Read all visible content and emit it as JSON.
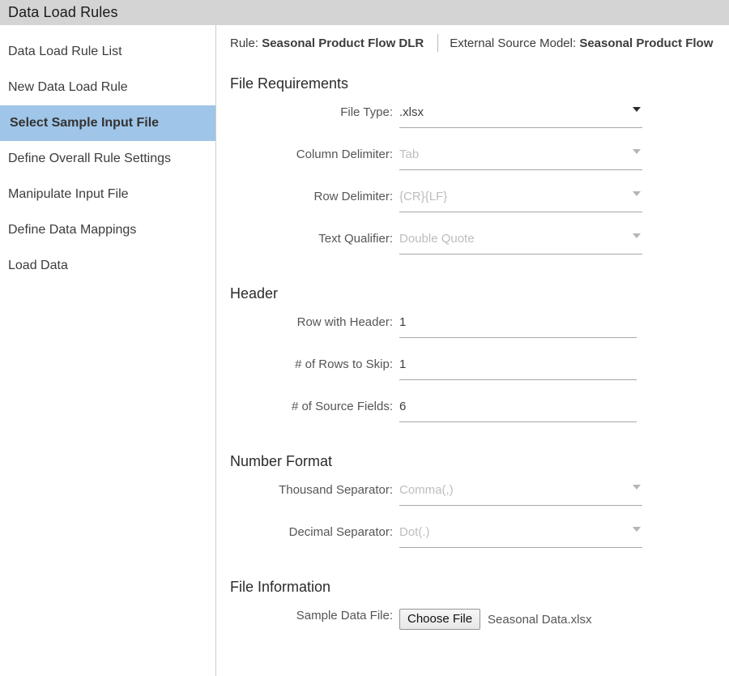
{
  "window": {
    "title": "Data Load Rules"
  },
  "sidebar": {
    "items": [
      {
        "label": "Data Load Rule List",
        "selected": false
      },
      {
        "label": "New Data Load Rule",
        "selected": false
      },
      {
        "label": "Select Sample Input File",
        "selected": true
      },
      {
        "label": "Define Overall Rule Settings",
        "selected": false
      },
      {
        "label": "Manipulate Input File",
        "selected": false
      },
      {
        "label": "Define Data Mappings",
        "selected": false
      },
      {
        "label": "Load Data",
        "selected": false
      }
    ],
    "selected_color": "#9fc5e8"
  },
  "context_bar": {
    "rule_label": "Rule:",
    "rule_value": "Seasonal Product Flow DLR",
    "model_label": "External Source Model:",
    "model_value": "Seasonal Product Flow"
  },
  "sections": {
    "file_requirements": {
      "title": "File Requirements",
      "fields": [
        {
          "label": "File Type:",
          "value": ".xlsx",
          "disabled": false
        },
        {
          "label": "Column Delimiter:",
          "value": "Tab",
          "disabled": true
        },
        {
          "label": "Row Delimiter:",
          "value": "{CR}{LF}",
          "disabled": true
        },
        {
          "label": "Text Qualifier:",
          "value": "Double Quote",
          "disabled": true
        }
      ]
    },
    "header": {
      "title": "Header",
      "fields": [
        {
          "label": "Row with Header:",
          "value": "1"
        },
        {
          "label": "# of Rows to Skip:",
          "value": "1"
        },
        {
          "label": "# of Source Fields:",
          "value": "6"
        }
      ]
    },
    "number_format": {
      "title": "Number Format",
      "fields": [
        {
          "label": "Thousand Separator:",
          "value": "Comma(,)",
          "disabled": true
        },
        {
          "label": "Decimal Separator:",
          "value": "Dot(.)",
          "disabled": true
        }
      ]
    },
    "file_information": {
      "title": "File Information",
      "sample_label": "Sample Data File:",
      "choose_button": "Choose File",
      "file_name": "Seasonal Data.xlsx"
    }
  }
}
